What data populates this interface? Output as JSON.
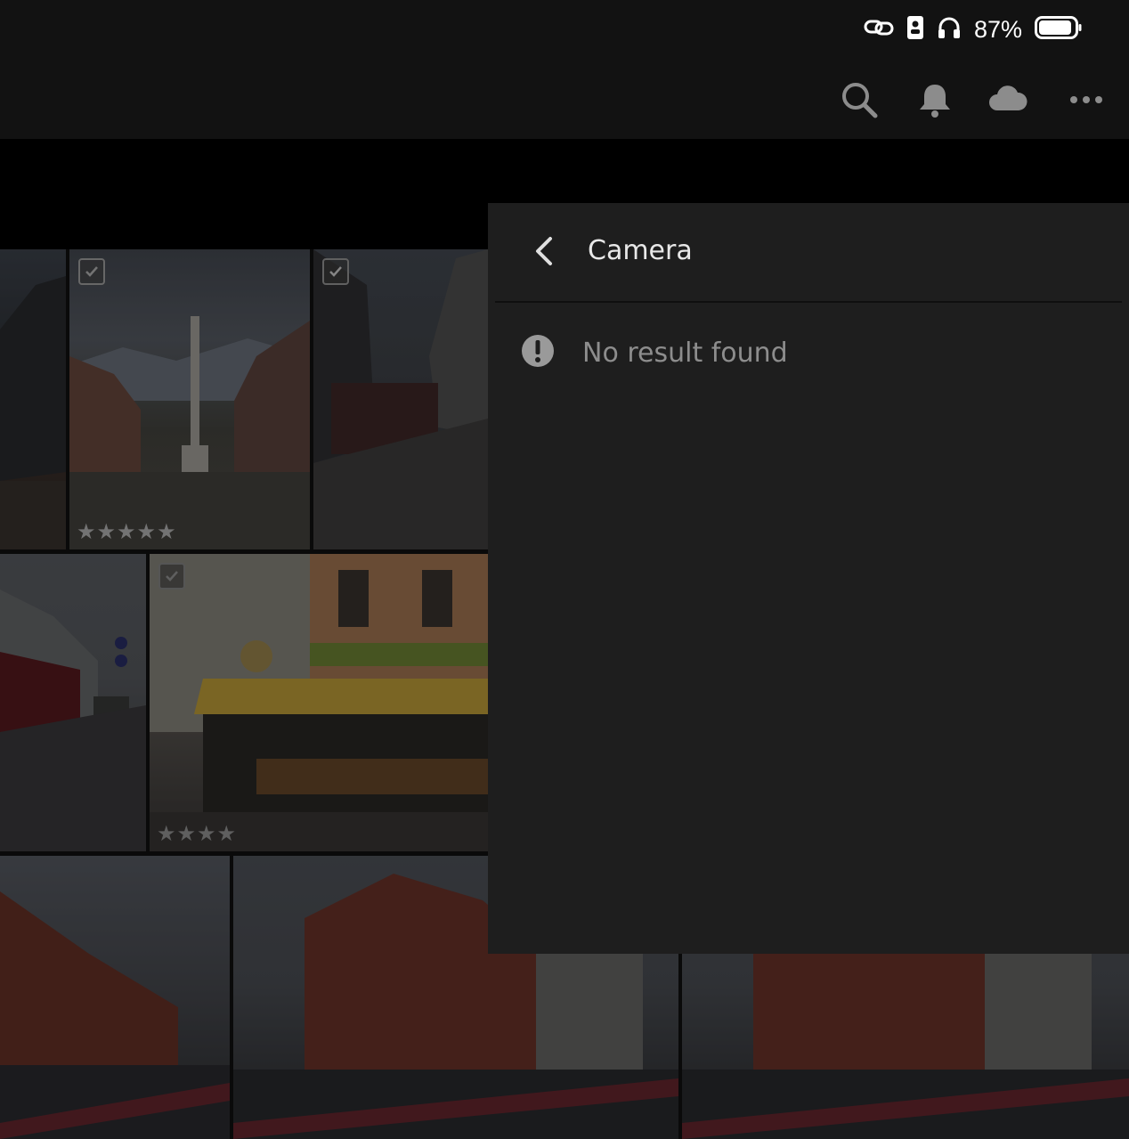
{
  "status_bar": {
    "battery_percent": "87%",
    "icons": [
      "link-icon",
      "sim-card-icon",
      "headphones-icon",
      "battery-icon"
    ]
  },
  "top_bar": {
    "icons": [
      "search-icon",
      "bell-icon",
      "cloud-icon",
      "more-icon"
    ]
  },
  "sub_bar": {
    "icons": [
      "share-icon",
      "filter-icon",
      "sort-icon"
    ]
  },
  "photos": [
    {
      "id": "photo-1",
      "checked": false,
      "stars": ""
    },
    {
      "id": "photo-2",
      "checked": true,
      "stars": "★★★★★"
    },
    {
      "id": "photo-3",
      "checked": true,
      "stars": ""
    },
    {
      "id": "photo-4",
      "checked": false,
      "stars": ""
    },
    {
      "id": "photo-5",
      "checked": true,
      "stars": "★★★★"
    },
    {
      "id": "photo-6",
      "checked": false,
      "stars": ""
    },
    {
      "id": "photo-7",
      "checked": false,
      "stars": ""
    },
    {
      "id": "photo-8",
      "checked": false,
      "stars": ""
    }
  ],
  "filter_panel": {
    "title": "Camera",
    "empty_message": "No result found"
  },
  "colors": {
    "panel_bg": "#1e1e1e",
    "bar_bg": "#121212",
    "icon_gray": "#8c8c8c"
  }
}
